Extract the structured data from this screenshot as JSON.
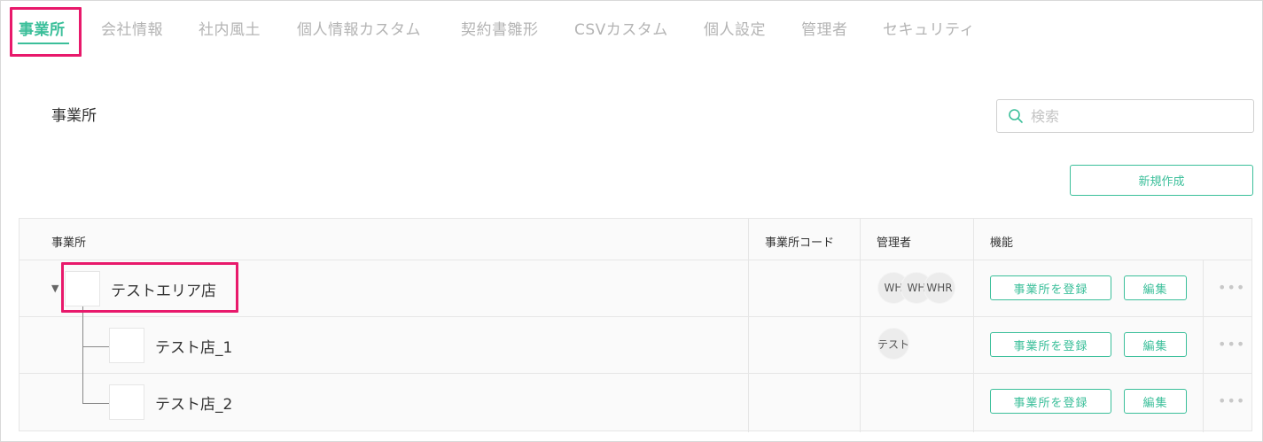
{
  "tabs": [
    {
      "label": "事業所",
      "active": true
    },
    {
      "label": "会社情報"
    },
    {
      "label": "社内風土"
    },
    {
      "label": "個人情報カスタム"
    },
    {
      "label": "契約書雛形"
    },
    {
      "label": "CSVカスタム"
    },
    {
      "label": "個人設定"
    },
    {
      "label": "管理者"
    },
    {
      "label": "セキュリティ"
    }
  ],
  "page": {
    "title": "事業所"
  },
  "search": {
    "placeholder": "検索",
    "value": ""
  },
  "new_button": {
    "label": "新規作成"
  },
  "table": {
    "headers": {
      "office": "事業所",
      "code": "事業所コード",
      "manager": "管理者",
      "function": "機能"
    },
    "rows": [
      {
        "name": "テストエリア店",
        "code": "",
        "managers": [
          "WH",
          "WH",
          "WHR"
        ],
        "register_label": "事業所を登録",
        "edit_label": "編集",
        "more": "•••",
        "expanded": true
      },
      {
        "name": "テスト店_1",
        "code": "",
        "managers": [
          "テスト"
        ],
        "register_label": "事業所を登録",
        "edit_label": "編集",
        "more": "•••"
      },
      {
        "name": "テスト店_2",
        "code": "",
        "managers": [],
        "register_label": "事業所を登録",
        "edit_label": "編集",
        "more": "•••"
      }
    ]
  },
  "colors": {
    "accent": "#3bbf9a",
    "highlight": "#e8196b",
    "inactive_tab": "#b4b4b4"
  }
}
